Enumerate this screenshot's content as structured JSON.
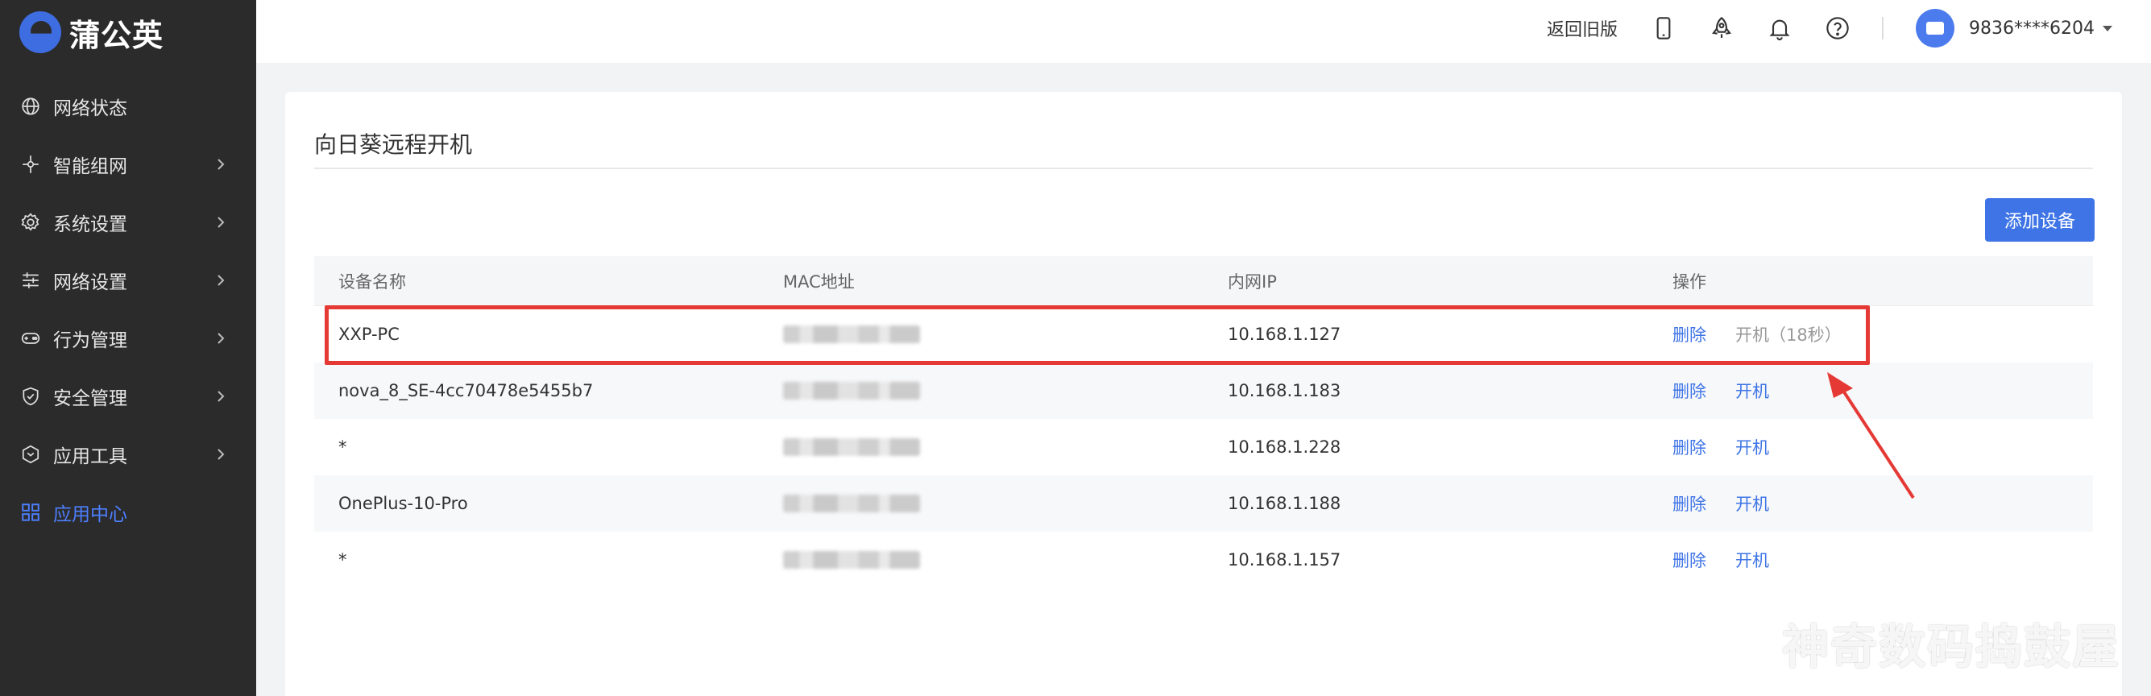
{
  "app": {
    "logo_text": "蒲公英"
  },
  "sidebar": {
    "items": [
      {
        "label": "网络状态",
        "icon": "globe-icon",
        "has_chevron": false,
        "active": false
      },
      {
        "label": "智能组网",
        "icon": "network-node-icon",
        "has_chevron": true,
        "active": false
      },
      {
        "label": "系统设置",
        "icon": "gear-icon",
        "has_chevron": true,
        "active": false
      },
      {
        "label": "网络设置",
        "icon": "sliders-icon",
        "has_chevron": true,
        "active": false
      },
      {
        "label": "行为管理",
        "icon": "gamepad-icon",
        "has_chevron": true,
        "active": false
      },
      {
        "label": "安全管理",
        "icon": "shield-icon",
        "has_chevron": true,
        "active": false
      },
      {
        "label": "应用工具",
        "icon": "hexagon-icon",
        "has_chevron": true,
        "active": false
      },
      {
        "label": "应用中心",
        "icon": "grid-icon",
        "has_chevron": false,
        "active": true
      }
    ],
    "active_color": "#4d7fff"
  },
  "topbar": {
    "back_link": "返回旧版",
    "icons": [
      "phone-icon",
      "rocket-icon",
      "bell-icon",
      "help-icon"
    ],
    "username": "9836****6204"
  },
  "main": {
    "title": "向日葵远程开机",
    "add_button": "添加设备",
    "table": {
      "headers": [
        "设备名称",
        "MAC地址",
        "内网IP",
        "操作"
      ],
      "rows": [
        {
          "name": "XXP-PC",
          "mac": "",
          "ip": "10.168.1.127",
          "delete": "删除",
          "power_on": "开机（18秒）",
          "power_on_disabled": true
        },
        {
          "name": "nova_8_SE-4cc70478e5455b7",
          "mac": "",
          "ip": "10.168.1.183",
          "delete": "删除",
          "power_on": "开机",
          "power_on_disabled": false
        },
        {
          "name": "*",
          "mac": "",
          "ip": "10.168.1.228",
          "delete": "删除",
          "power_on": "开机",
          "power_on_disabled": false
        },
        {
          "name": "OnePlus-10-Pro",
          "mac": "",
          "ip": "10.168.1.188",
          "delete": "删除",
          "power_on": "开机",
          "power_on_disabled": false
        },
        {
          "name": "*",
          "mac": "",
          "ip": "10.168.1.157",
          "delete": "删除",
          "power_on": "开机",
          "power_on_disabled": false
        }
      ]
    }
  },
  "annotation": {
    "highlight_color": "#e53935"
  },
  "watermark": "神奇数码捣鼓屋",
  "colors": {
    "sidebar_bg": "#2b2b2b",
    "accent": "#3e74e6",
    "page_bg": "#f2f3f5"
  }
}
